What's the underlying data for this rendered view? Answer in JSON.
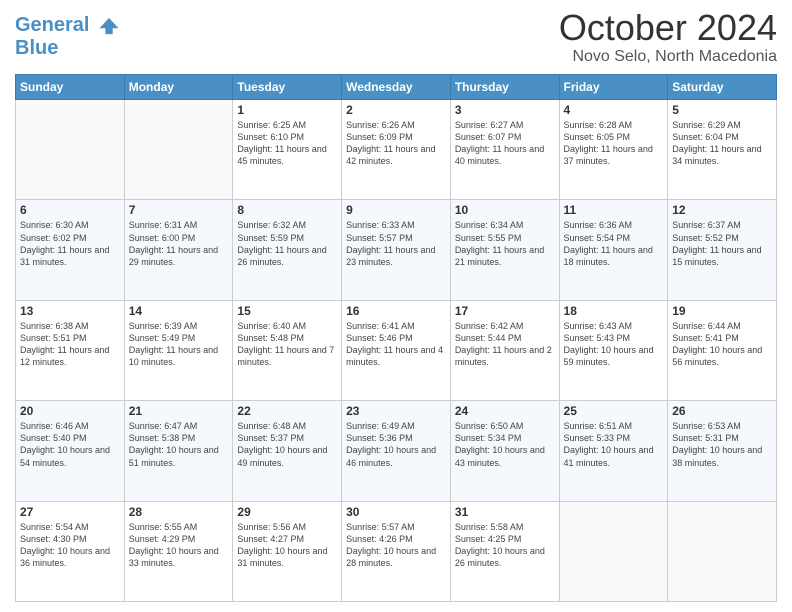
{
  "header": {
    "logo_line1": "General",
    "logo_line2": "Blue",
    "month_title": "October 2024",
    "subtitle": "Novo Selo, North Macedonia"
  },
  "weekdays": [
    "Sunday",
    "Monday",
    "Tuesday",
    "Wednesday",
    "Thursday",
    "Friday",
    "Saturday"
  ],
  "weeks": [
    [
      null,
      null,
      {
        "day": 1,
        "sunrise": "6:25 AM",
        "sunset": "6:10 PM",
        "daylight": "11 hours and 45 minutes."
      },
      {
        "day": 2,
        "sunrise": "6:26 AM",
        "sunset": "6:09 PM",
        "daylight": "11 hours and 42 minutes."
      },
      {
        "day": 3,
        "sunrise": "6:27 AM",
        "sunset": "6:07 PM",
        "daylight": "11 hours and 40 minutes."
      },
      {
        "day": 4,
        "sunrise": "6:28 AM",
        "sunset": "6:05 PM",
        "daylight": "11 hours and 37 minutes."
      },
      {
        "day": 5,
        "sunrise": "6:29 AM",
        "sunset": "6:04 PM",
        "daylight": "11 hours and 34 minutes."
      }
    ],
    [
      {
        "day": 6,
        "sunrise": "6:30 AM",
        "sunset": "6:02 PM",
        "daylight": "11 hours and 31 minutes."
      },
      {
        "day": 7,
        "sunrise": "6:31 AM",
        "sunset": "6:00 PM",
        "daylight": "11 hours and 29 minutes."
      },
      {
        "day": 8,
        "sunrise": "6:32 AM",
        "sunset": "5:59 PM",
        "daylight": "11 hours and 26 minutes."
      },
      {
        "day": 9,
        "sunrise": "6:33 AM",
        "sunset": "5:57 PM",
        "daylight": "11 hours and 23 minutes."
      },
      {
        "day": 10,
        "sunrise": "6:34 AM",
        "sunset": "5:55 PM",
        "daylight": "11 hours and 21 minutes."
      },
      {
        "day": 11,
        "sunrise": "6:36 AM",
        "sunset": "5:54 PM",
        "daylight": "11 hours and 18 minutes."
      },
      {
        "day": 12,
        "sunrise": "6:37 AM",
        "sunset": "5:52 PM",
        "daylight": "11 hours and 15 minutes."
      }
    ],
    [
      {
        "day": 13,
        "sunrise": "6:38 AM",
        "sunset": "5:51 PM",
        "daylight": "11 hours and 12 minutes."
      },
      {
        "day": 14,
        "sunrise": "6:39 AM",
        "sunset": "5:49 PM",
        "daylight": "11 hours and 10 minutes."
      },
      {
        "day": 15,
        "sunrise": "6:40 AM",
        "sunset": "5:48 PM",
        "daylight": "11 hours and 7 minutes."
      },
      {
        "day": 16,
        "sunrise": "6:41 AM",
        "sunset": "5:46 PM",
        "daylight": "11 hours and 4 minutes."
      },
      {
        "day": 17,
        "sunrise": "6:42 AM",
        "sunset": "5:44 PM",
        "daylight": "11 hours and 2 minutes."
      },
      {
        "day": 18,
        "sunrise": "6:43 AM",
        "sunset": "5:43 PM",
        "daylight": "10 hours and 59 minutes."
      },
      {
        "day": 19,
        "sunrise": "6:44 AM",
        "sunset": "5:41 PM",
        "daylight": "10 hours and 56 minutes."
      }
    ],
    [
      {
        "day": 20,
        "sunrise": "6:46 AM",
        "sunset": "5:40 PM",
        "daylight": "10 hours and 54 minutes."
      },
      {
        "day": 21,
        "sunrise": "6:47 AM",
        "sunset": "5:38 PM",
        "daylight": "10 hours and 51 minutes."
      },
      {
        "day": 22,
        "sunrise": "6:48 AM",
        "sunset": "5:37 PM",
        "daylight": "10 hours and 49 minutes."
      },
      {
        "day": 23,
        "sunrise": "6:49 AM",
        "sunset": "5:36 PM",
        "daylight": "10 hours and 46 minutes."
      },
      {
        "day": 24,
        "sunrise": "6:50 AM",
        "sunset": "5:34 PM",
        "daylight": "10 hours and 43 minutes."
      },
      {
        "day": 25,
        "sunrise": "6:51 AM",
        "sunset": "5:33 PM",
        "daylight": "10 hours and 41 minutes."
      },
      {
        "day": 26,
        "sunrise": "6:53 AM",
        "sunset": "5:31 PM",
        "daylight": "10 hours and 38 minutes."
      }
    ],
    [
      {
        "day": 27,
        "sunrise": "5:54 AM",
        "sunset": "4:30 PM",
        "daylight": "10 hours and 36 minutes."
      },
      {
        "day": 28,
        "sunrise": "5:55 AM",
        "sunset": "4:29 PM",
        "daylight": "10 hours and 33 minutes."
      },
      {
        "day": 29,
        "sunrise": "5:56 AM",
        "sunset": "4:27 PM",
        "daylight": "10 hours and 31 minutes."
      },
      {
        "day": 30,
        "sunrise": "5:57 AM",
        "sunset": "4:26 PM",
        "daylight": "10 hours and 28 minutes."
      },
      {
        "day": 31,
        "sunrise": "5:58 AM",
        "sunset": "4:25 PM",
        "daylight": "10 hours and 26 minutes."
      },
      null,
      null
    ]
  ]
}
